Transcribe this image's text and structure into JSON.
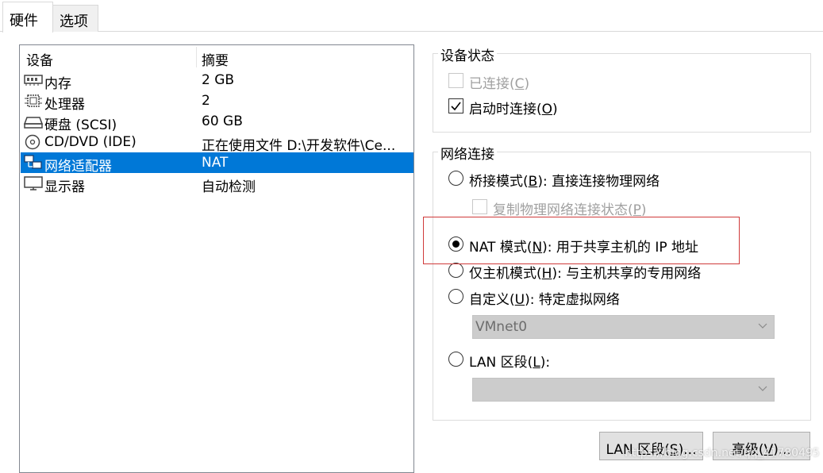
{
  "tabs": [
    {
      "label": "硬件",
      "active": true
    },
    {
      "label": "选项",
      "active": false
    }
  ],
  "device_list": {
    "headers": {
      "device": "设备",
      "summary": "摘要"
    },
    "rows": [
      {
        "icon": "memory-icon",
        "name": "内存",
        "summary": "2 GB",
        "selected": false
      },
      {
        "icon": "processor-icon",
        "name": "处理器",
        "summary": "2",
        "selected": false
      },
      {
        "icon": "hard-disk-icon",
        "name": "硬盘 (SCSI)",
        "summary": "60 GB",
        "selected": false
      },
      {
        "icon": "cd-dvd-icon",
        "name": "CD/DVD (IDE)",
        "summary": "正在使用文件 D:\\开发软件\\Ce...",
        "selected": false
      },
      {
        "icon": "network-adapter-icon",
        "name": "网络适配器",
        "summary": "NAT",
        "selected": true
      },
      {
        "icon": "display-icon",
        "name": "显示器",
        "summary": "自动检测",
        "selected": false
      }
    ]
  },
  "device_status": {
    "title": "设备状态",
    "connected": {
      "pre": "已连接(",
      "key": "C",
      "post": ")",
      "checked": false,
      "enabled": false
    },
    "connect_at_power_on": {
      "pre": "启动时连接(",
      "key": "O",
      "post": ")",
      "checked": true,
      "enabled": true
    }
  },
  "network_connection": {
    "title": "网络连接",
    "bridged": {
      "pre": "桥接模式(",
      "key": "B",
      "post": "): 直接连接物理网络",
      "selected": false
    },
    "replicate": {
      "pre": "复制物理网络连接状态(",
      "key": "P",
      "post": ")",
      "checked": false,
      "enabled": false
    },
    "nat": {
      "pre": "NAT 模式(",
      "key": "N",
      "post": "): 用于共享主机的 IP 地址",
      "selected": true
    },
    "host_only": {
      "pre": "仅主机模式(",
      "key": "H",
      "post": "): 与主机共享的专用网络",
      "selected": false
    },
    "custom": {
      "pre": "自定义(",
      "key": "U",
      "post": "): 特定虚拟网络",
      "selected": false
    },
    "custom_select_value": "VMnet0",
    "lan_segment": {
      "pre": "LAN 区段(",
      "key": "L",
      "post": "):",
      "selected": false
    },
    "lan_select_value": ""
  },
  "buttons": {
    "lan_segments": {
      "pre": "LAN 区段(",
      "key": "S",
      "post": ")..."
    },
    "advanced": {
      "pre": "高级(",
      "key": "V",
      "post": ")..."
    }
  },
  "watermark": "https://blog.csdn.net/qq_41780495",
  "colors": {
    "selection": "#0078d7",
    "highlight_box": "#d03a3a",
    "disabled_text": "#a0a0a0"
  }
}
